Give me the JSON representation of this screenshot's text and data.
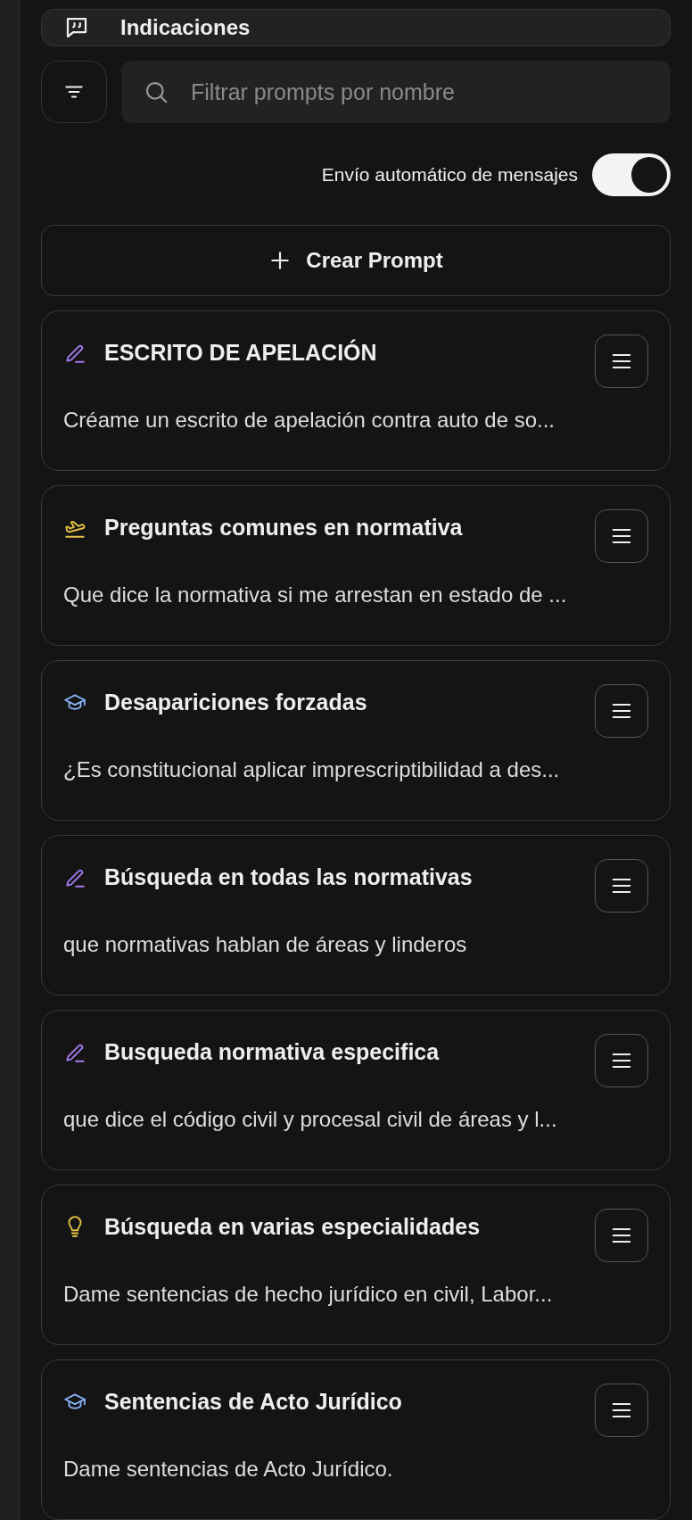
{
  "header": {
    "title": "Indicaciones"
  },
  "search": {
    "placeholder": "Filtrar prompts por nombre"
  },
  "auto_send": {
    "label": "Envío automático de mensajes",
    "on": true
  },
  "create_button": {
    "label": "Crear Prompt"
  },
  "prompts": [
    {
      "title": "ESCRITO DE APELACIÓN",
      "text": "Créame un escrito de apelación contra auto de so...",
      "kind": "pencil",
      "color": "#a77bf3"
    },
    {
      "title": "Preguntas comunes en normativa",
      "text": "Que dice la normativa si me arrestan en estado de ...",
      "kind": "plane",
      "color": "#e8c547"
    },
    {
      "title": "Desapariciones forzadas",
      "text": "¿Es constitucional aplicar imprescriptibilidad a des...",
      "kind": "cap",
      "color": "#8ab4f8"
    },
    {
      "title": "Búsqueda en todas las normativas",
      "text": "que normativas hablan de áreas y linderos",
      "kind": "pencil",
      "color": "#a77bf3"
    },
    {
      "title": "Busqueda normativa especifica",
      "text": "que dice el código civil y procesal civil de áreas y l...",
      "kind": "pencil",
      "color": "#a77bf3"
    },
    {
      "title": "Búsqueda en varias especialidades",
      "text": "Dame sentencias de hecho jurídico en civil, Labor...",
      "kind": "bulb",
      "color": "#e8c547"
    },
    {
      "title": "Sentencias de Acto Jurídico",
      "text": "Dame sentencias de Acto Jurídico.",
      "kind": "cap",
      "color": "#8ab4f8"
    }
  ]
}
